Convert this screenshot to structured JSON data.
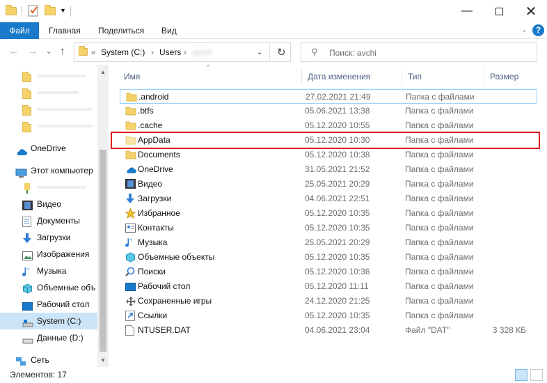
{
  "ribbon": {
    "file": "Файл",
    "home": "Главная",
    "share": "Поделиться",
    "view": "Вид"
  },
  "address": {
    "overflow": "«",
    "drive": "System (C:)",
    "users": "Users",
    "user": "avchi"
  },
  "search": {
    "placeholder": "Поиск: avchi"
  },
  "sidebar": {
    "onedrive": "OneDrive",
    "this_pc": "Этот компьютер",
    "items": [
      "Видео",
      "Документы",
      "Загрузки",
      "Изображения",
      "Музыка",
      "Объемные объ",
      "Рабочий стол",
      "System (C:)",
      "Данные (D:)"
    ],
    "network": "Сеть"
  },
  "columns": {
    "name": "Имя",
    "date": "Дата изменения",
    "type": "Тип",
    "size": "Размер"
  },
  "files": [
    {
      "name": ".android",
      "date": "27.02.2021 21:49",
      "type": "Папка с файлами",
      "size": ""
    },
    {
      "name": ".btfs",
      "date": "05.06.2021 13:38",
      "type": "Папка с файлами",
      "size": ""
    },
    {
      "name": ".cache",
      "date": "05.12.2020 10:55",
      "type": "Папка с файлами",
      "size": ""
    },
    {
      "name": "AppData",
      "date": "05.12.2020 10:30",
      "type": "Папка с файлами",
      "size": ""
    },
    {
      "name": "Documents",
      "date": "05.12.2020 10:38",
      "type": "Папка с файлами",
      "size": ""
    },
    {
      "name": "OneDrive",
      "date": "31.05.2021 21:52",
      "type": "Папка с файлами",
      "size": ""
    },
    {
      "name": "Видео",
      "date": "25.05.2021 20:29",
      "type": "Папка с файлами",
      "size": ""
    },
    {
      "name": "Загрузки",
      "date": "04.06.2021 22:51",
      "type": "Папка с файлами",
      "size": ""
    },
    {
      "name": "Избранное",
      "date": "05.12.2020 10:35",
      "type": "Папка с файлами",
      "size": ""
    },
    {
      "name": "Контакты",
      "date": "05.12.2020 10:35",
      "type": "Папка с файлами",
      "size": ""
    },
    {
      "name": "Музыка",
      "date": "25.05.2021 20:29",
      "type": "Папка с файлами",
      "size": ""
    },
    {
      "name": "Объемные объекты",
      "date": "05.12.2020 10:35",
      "type": "Папка с файлами",
      "size": ""
    },
    {
      "name": "Поиски",
      "date": "05.12.2020 10:36",
      "type": "Папка с файлами",
      "size": ""
    },
    {
      "name": "Рабочий стол",
      "date": "05.12.2020 11:11",
      "type": "Папка с файлами",
      "size": ""
    },
    {
      "name": "Сохраненные игры",
      "date": "24.12.2020 21:25",
      "type": "Папка с файлами",
      "size": ""
    },
    {
      "name": "Ссылки",
      "date": "05.12.2020 10:35",
      "type": "Папка с файлами",
      "size": ""
    },
    {
      "name": "NTUSER.DAT",
      "date": "04.06.2021 23:04",
      "type": "Файл \"DAT\"",
      "size": "3 328 КБ"
    }
  ],
  "status": {
    "count": "Элементов: 17"
  },
  "colors": {
    "accent": "#1979ca",
    "highlight": "#e11d1d",
    "folder": "#f5d36a"
  }
}
